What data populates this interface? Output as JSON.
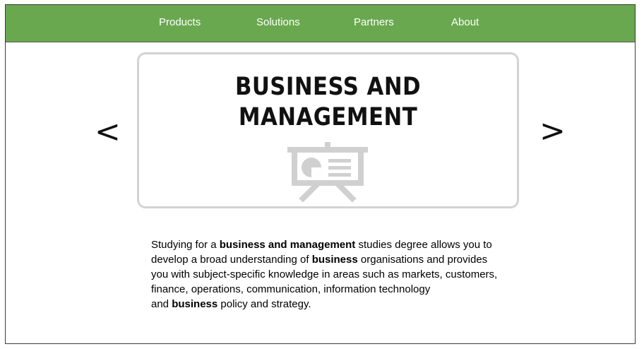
{
  "nav": {
    "items": [
      {
        "label": "Products"
      },
      {
        "label": "Solutions"
      },
      {
        "label": "Partners"
      },
      {
        "label": "About"
      }
    ]
  },
  "carousel": {
    "prev_label": "<",
    "next_label": ">",
    "slide": {
      "title_line1": "BUSINESS AND",
      "title_line2": "MANAGEMENT",
      "icon": "presentation-board-icon"
    }
  },
  "description": {
    "lines": [
      [
        {
          "text": "Studying for a ",
          "bold": false
        },
        {
          "text": "business and management",
          "bold": true
        },
        {
          "text": " studies degree allows you to",
          "bold": false
        }
      ],
      [
        {
          "text": "develop a broad understanding of ",
          "bold": false
        },
        {
          "text": "business",
          "bold": true
        },
        {
          "text": " organisations and provides",
          "bold": false
        }
      ],
      [
        {
          "text": "you with subject-specific knowledge in areas such as markets, customers,",
          "bold": false
        }
      ],
      [
        {
          "text": "finance, operations, communication, information technology",
          "bold": false
        }
      ],
      [
        {
          "text": "and ",
          "bold": false
        },
        {
          "text": "business",
          "bold": true
        },
        {
          "text": " policy and strategy.",
          "bold": false
        }
      ]
    ]
  },
  "colors": {
    "nav_background": "#6aa84f",
    "nav_text": "#ffffff",
    "slide_border": "#d3d3d3",
    "icon_gray": "#d0d0d0"
  }
}
